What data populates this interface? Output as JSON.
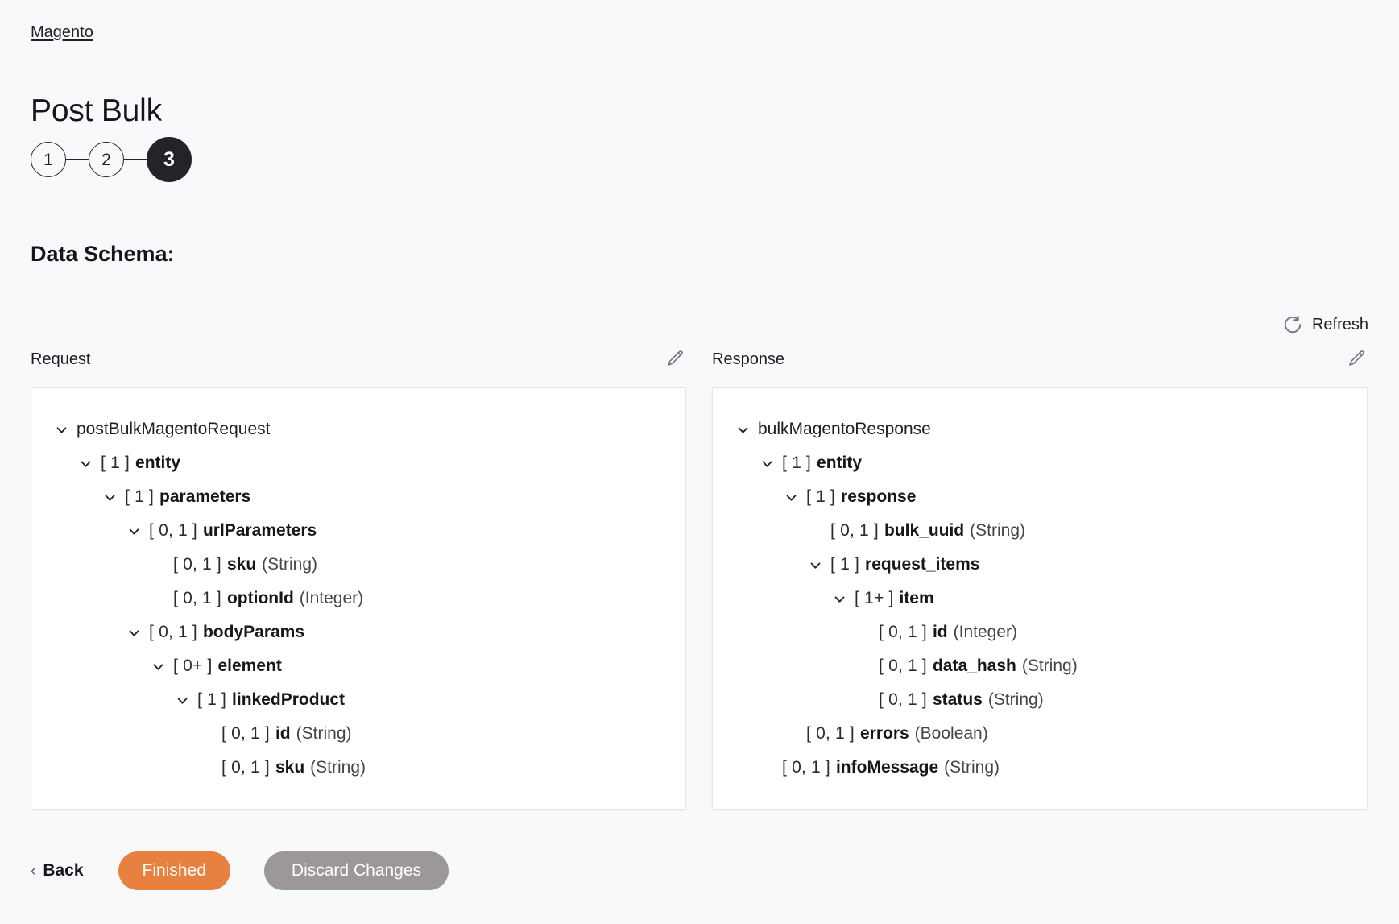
{
  "breadcrumb": {
    "label": "Magento"
  },
  "page": {
    "title": "Post Bulk",
    "section_heading": "Data Schema:"
  },
  "stepper": {
    "steps": [
      {
        "label": "1",
        "active": false
      },
      {
        "label": "2",
        "active": false
      },
      {
        "label": "3",
        "active": true
      }
    ]
  },
  "refresh": {
    "label": "Refresh",
    "icon": "refresh-icon"
  },
  "request_panel": {
    "label": "Request",
    "edit_icon": "pencil-icon",
    "tree": [
      {
        "depth": 0,
        "expandable": true,
        "cardinality": "",
        "name": "postBulkMagentoRequest",
        "type": "",
        "bold": false
      },
      {
        "depth": 1,
        "expandable": true,
        "cardinality": "[ 1 ]",
        "name": "entity",
        "type": "",
        "bold": true
      },
      {
        "depth": 2,
        "expandable": true,
        "cardinality": "[ 1 ]",
        "name": "parameters",
        "type": "",
        "bold": true
      },
      {
        "depth": 3,
        "expandable": true,
        "cardinality": "[ 0, 1 ]",
        "name": "urlParameters",
        "type": "",
        "bold": true
      },
      {
        "depth": 4,
        "expandable": false,
        "cardinality": "[ 0, 1 ]",
        "name": "sku",
        "type": "(String)",
        "bold": true
      },
      {
        "depth": 4,
        "expandable": false,
        "cardinality": "[ 0, 1 ]",
        "name": "optionId",
        "type": "(Integer)",
        "bold": true
      },
      {
        "depth": 3,
        "expandable": true,
        "cardinality": "[ 0, 1 ]",
        "name": "bodyParams",
        "type": "",
        "bold": true
      },
      {
        "depth": 4,
        "expandable": true,
        "cardinality": "[ 0+ ]",
        "name": "element",
        "type": "",
        "bold": true
      },
      {
        "depth": 5,
        "expandable": true,
        "cardinality": "[ 1 ]",
        "name": "linkedProduct",
        "type": "",
        "bold": true
      },
      {
        "depth": 6,
        "expandable": false,
        "cardinality": "[ 0, 1 ]",
        "name": "id",
        "type": "(String)",
        "bold": true
      },
      {
        "depth": 6,
        "expandable": false,
        "cardinality": "[ 0, 1 ]",
        "name": "sku",
        "type": "(String)",
        "bold": true
      }
    ]
  },
  "response_panel": {
    "label": "Response",
    "edit_icon": "pencil-icon",
    "tree": [
      {
        "depth": 0,
        "expandable": true,
        "cardinality": "",
        "name": "bulkMagentoResponse",
        "type": "",
        "bold": false
      },
      {
        "depth": 1,
        "expandable": true,
        "cardinality": "[ 1 ]",
        "name": "entity",
        "type": "",
        "bold": true
      },
      {
        "depth": 2,
        "expandable": true,
        "cardinality": "[ 1 ]",
        "name": "response",
        "type": "",
        "bold": true
      },
      {
        "depth": 3,
        "expandable": false,
        "cardinality": "[ 0, 1 ]",
        "name": "bulk_uuid",
        "type": "(String)",
        "bold": true
      },
      {
        "depth": 3,
        "expandable": true,
        "cardinality": "[ 1 ]",
        "name": "request_items",
        "type": "",
        "bold": true
      },
      {
        "depth": 4,
        "expandable": true,
        "cardinality": "[ 1+ ]",
        "name": "item",
        "type": "",
        "bold": true
      },
      {
        "depth": 5,
        "expandable": false,
        "cardinality": "[ 0, 1 ]",
        "name": "id",
        "type": "(Integer)",
        "bold": true
      },
      {
        "depth": 5,
        "expandable": false,
        "cardinality": "[ 0, 1 ]",
        "name": "data_hash",
        "type": "(String)",
        "bold": true
      },
      {
        "depth": 5,
        "expandable": false,
        "cardinality": "[ 0, 1 ]",
        "name": "status",
        "type": "(String)",
        "bold": true
      },
      {
        "depth": 2,
        "expandable": false,
        "cardinality": "[ 0, 1 ]",
        "name": "errors",
        "type": "(Boolean)",
        "bold": true
      },
      {
        "depth": 1,
        "expandable": false,
        "cardinality": "[ 0, 1 ]",
        "name": "infoMessage",
        "type": "(String)",
        "bold": true
      }
    ]
  },
  "footer": {
    "back_label": "Back",
    "back_chevron": "chevron-left-icon",
    "primary_label": "Finished",
    "secondary_label": "Discard Changes"
  },
  "colors": {
    "page_bg": "#f8f9fa",
    "panel_bg": "#ffffff",
    "panel_border": "#e4e6e9",
    "text": "#1f2024",
    "step_active_bg": "#23242a",
    "primary_button": "#e8813f",
    "secondary_button": "#9b979b",
    "icon_gray": "#6f7278"
  }
}
